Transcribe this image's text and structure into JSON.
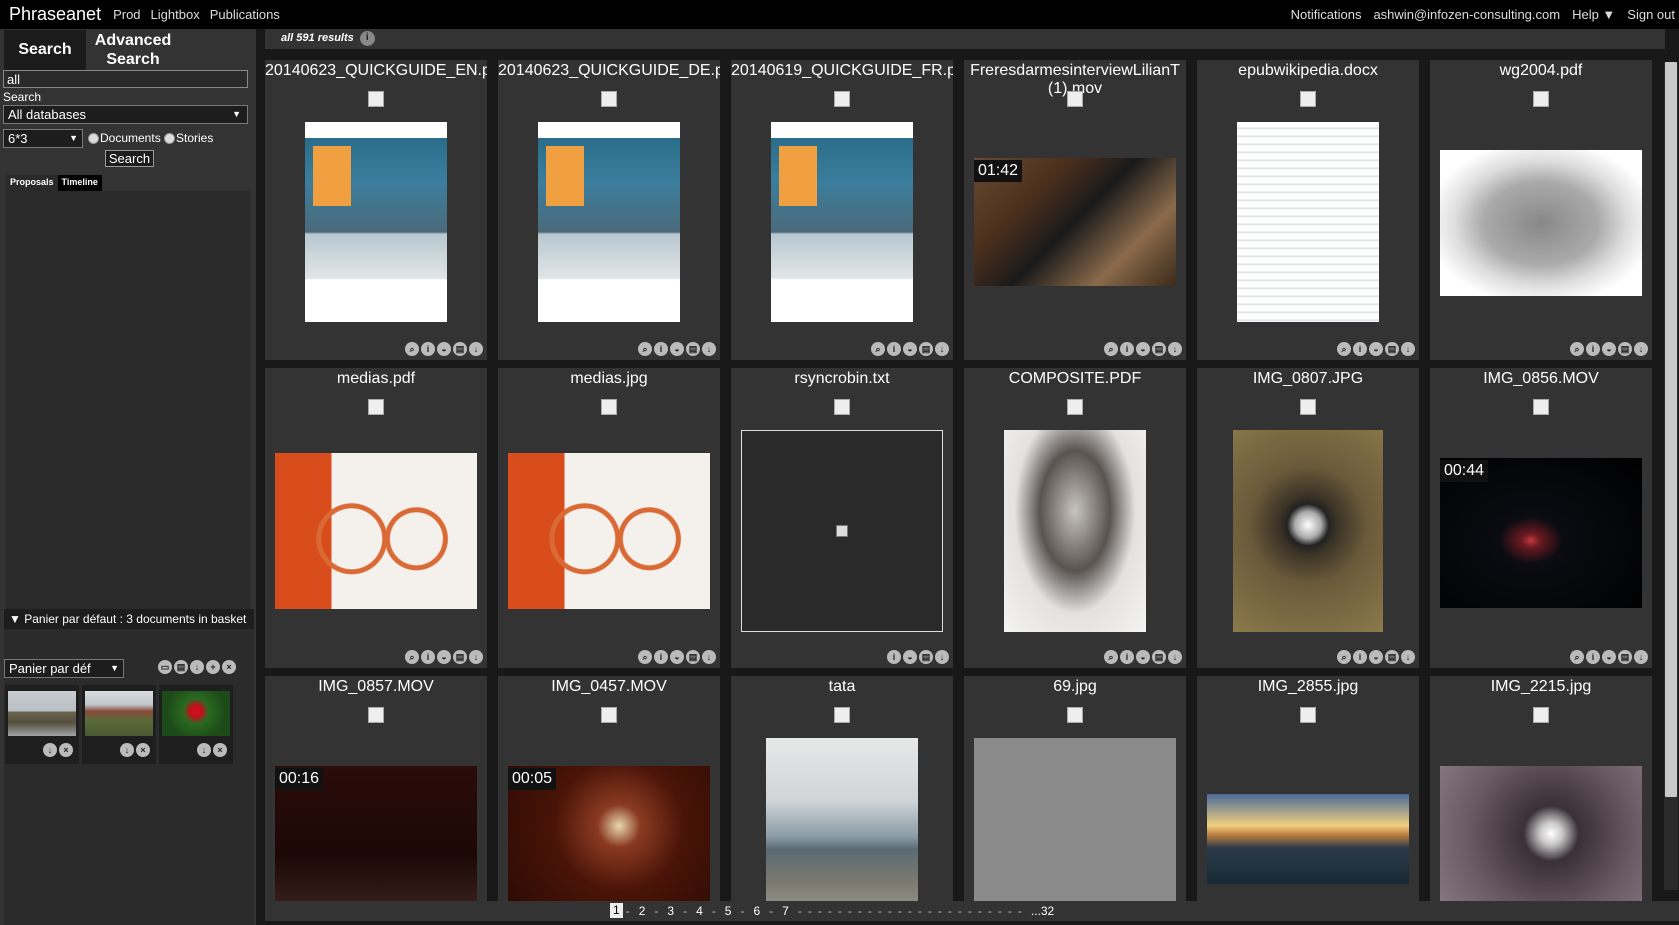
{
  "topbar": {
    "brand": "Phraseanet",
    "nav": [
      "Prod",
      "Lightbox",
      "Publications"
    ],
    "right": [
      "Notifications",
      "ashwin@infozen-consulting.com",
      "Help ▼",
      "Sign out"
    ]
  },
  "sidebar": {
    "tab_search": "Search",
    "tab_advanced": "Advanced Search",
    "query_value": "all",
    "search_label": "Search",
    "database_select": "All databases",
    "per_page_select": "6*3",
    "radio_documents": "Documents",
    "radio_stories": "Stories",
    "search_button": "Search",
    "subtab_proposals": "Proposals",
    "subtab_timeline": "Timeline",
    "basket_header": "Panier par défaut : 3 documents in basket",
    "basket_select": "Panier par déf"
  },
  "results_bar": {
    "text": "all 591 results",
    "info_icon": "i"
  },
  "grid": [
    {
      "title": "20140623_QUICKGUIDE_EN.p",
      "kind": "guide",
      "accent": "#f0a040"
    },
    {
      "title": "20140623_QUICKGUIDE_DE.p",
      "kind": "guide",
      "accent": "#f0a040"
    },
    {
      "title": "20140619_QUICKGUIDE_FR.p",
      "kind": "guide",
      "accent": "#f0a040"
    },
    {
      "title": "FreresdarmesinterviewLilianT (1).mov",
      "kind": "video",
      "duration": "01:42"
    },
    {
      "title": "epubwikipedia.docx",
      "kind": "doc"
    },
    {
      "title": "wg2004.pdf",
      "kind": "map"
    },
    {
      "title": "medias.pdf",
      "kind": "medias"
    },
    {
      "title": "medias.jpg",
      "kind": "medias"
    },
    {
      "title": "rsyncrobin.txt",
      "kind": "txt"
    },
    {
      "title": "COMPOSITE.PDF",
      "kind": "portrait"
    },
    {
      "title": "IMG_0807.JPG",
      "kind": "lens"
    },
    {
      "title": "IMG_0856.MOV",
      "kind": "night",
      "duration": "00:44"
    },
    {
      "title": "IMG_0857.MOV",
      "kind": "dark",
      "duration": "00:16"
    },
    {
      "title": "IMG_0457.MOV",
      "kind": "party",
      "duration": "00:05"
    },
    {
      "title": "tata",
      "kind": "sea"
    },
    {
      "title": "69.jpg",
      "kind": "watermark"
    },
    {
      "title": "IMG_2855.jpg",
      "kind": "sunset"
    },
    {
      "title": "IMG_2215.jpg",
      "kind": "flower"
    }
  ],
  "pager": {
    "pages": [
      "1",
      "2",
      "3",
      "4",
      "5",
      "6",
      "7"
    ],
    "last": "...32"
  }
}
